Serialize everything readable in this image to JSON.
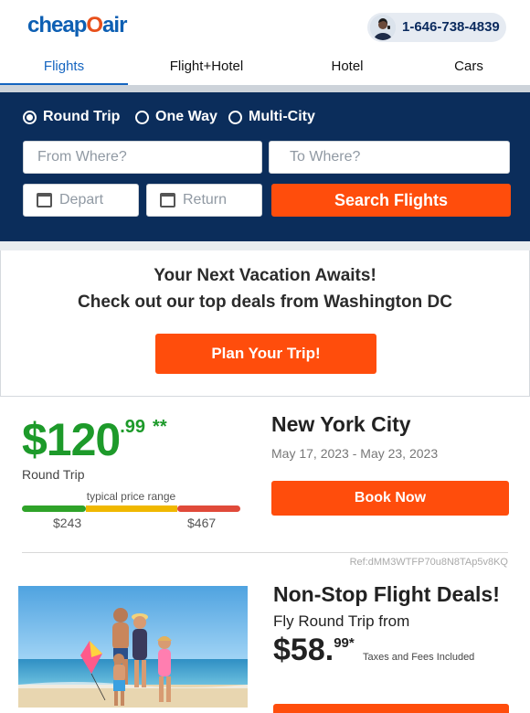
{
  "header": {
    "logo_text_a": "cheap",
    "logo_text_o": "O",
    "logo_text_b": "air",
    "phone": "1-646-738-4839"
  },
  "tabs": [
    {
      "label": "Flights",
      "active": true
    },
    {
      "label": "Flight+Hotel",
      "active": false
    },
    {
      "label": "Hotel",
      "active": false
    },
    {
      "label": "Cars",
      "active": false
    }
  ],
  "search": {
    "trip_types": [
      {
        "label": "Round Trip",
        "selected": true
      },
      {
        "label": "One Way",
        "selected": false
      },
      {
        "label": "Multi-City",
        "selected": false
      }
    ],
    "from_placeholder": "From Where?",
    "to_placeholder": "To Where?",
    "depart_placeholder": "Depart",
    "return_placeholder": "Return",
    "button_label": "Search Flights"
  },
  "promo": {
    "line1": "Your Next Vacation Awaits!",
    "line2": "Check out our top deals from Washington DC",
    "button_label": "Plan Your Trip!"
  },
  "deal": {
    "price_dollars": "$120",
    "price_cents": ".99",
    "price_mark": "**",
    "trip_type": "Round Trip",
    "range_label": "typical price range",
    "range_low": "$243",
    "range_high": "$467",
    "city": "New York City",
    "dates": "May 17, 2023 - May 23, 2023",
    "book_label": "Book Now",
    "ref": "Ref:dMM3WTFP70u8N8TAp5v8KQ"
  },
  "nonstop": {
    "title": "Non-Stop Flight Deals!",
    "subtitle": "Fly Round Trip from",
    "price_dollars": "$58.",
    "price_cents": "99*",
    "taxes_note": "Taxes and Fees Included"
  },
  "colors": {
    "brand_blue": "#0d5fb3",
    "navy": "#0b2d5b",
    "accent_orange": "#ff4d0c",
    "price_green": "#1d9a2a",
    "range_green": "#2fa329",
    "range_yellow": "#f0b800",
    "range_red": "#e04a3a"
  }
}
